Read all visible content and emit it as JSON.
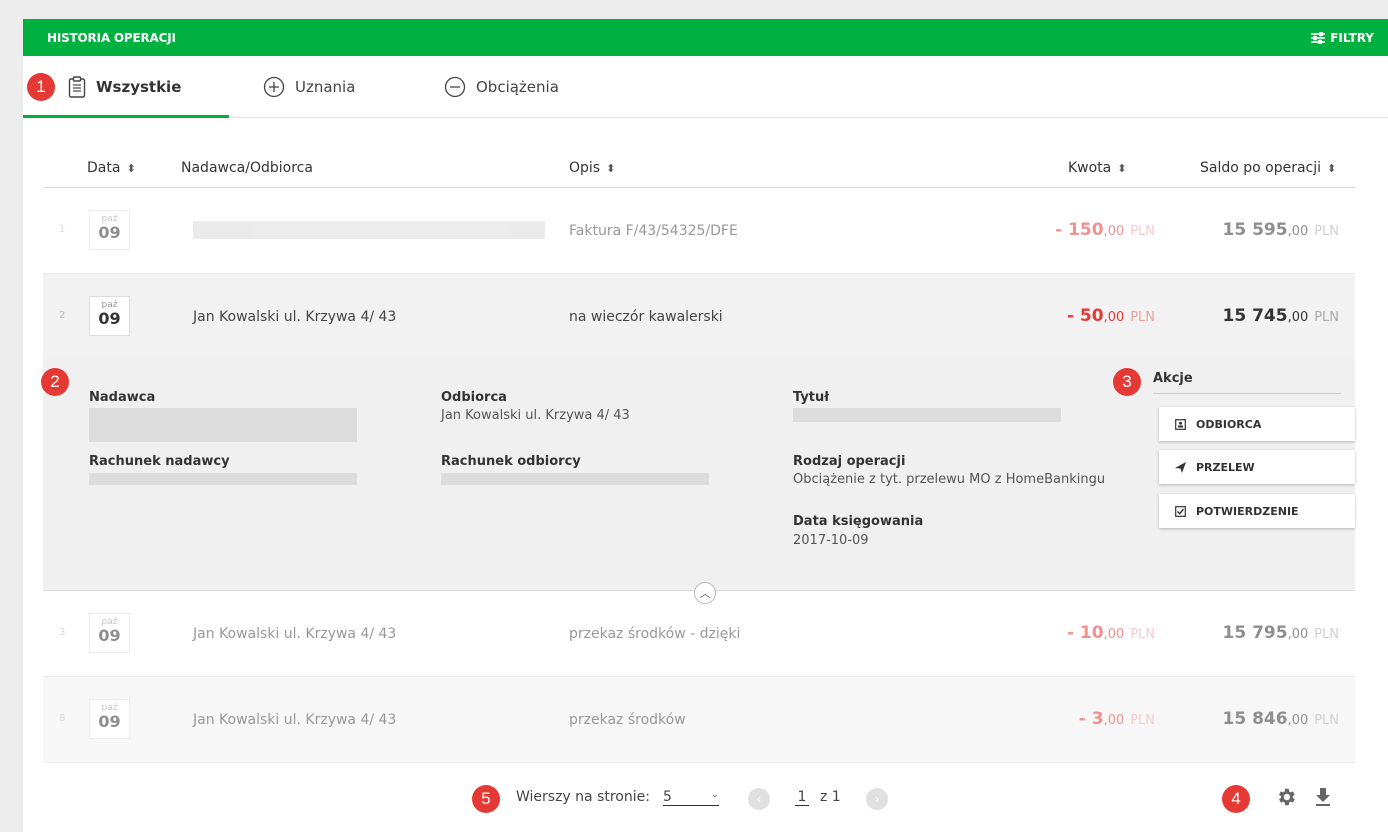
{
  "header": {
    "title": "HISTORIA OPERACJI",
    "filters_label": "FILTRY"
  },
  "tabs": [
    {
      "label": "Wszystkie",
      "icon": "clipboard-icon"
    },
    {
      "label": "Uznania",
      "icon": "plus-circle-icon"
    },
    {
      "label": "Obciążenia",
      "icon": "minus-circle-icon"
    }
  ],
  "badges": [
    "1",
    "2",
    "3",
    "4",
    "5"
  ],
  "columns": {
    "date": "Data",
    "party": "Nadawca/Odbiorca",
    "desc": "Opis",
    "amount": "Kwota",
    "balance": "Saldo po operacji"
  },
  "rows": [
    {
      "num": "1",
      "month": "paź",
      "day": "09",
      "party": "",
      "desc": "Faktura F/43/54325/DFE",
      "amount_int": "- 150",
      "amount_dec": ",00",
      "currency": "PLN",
      "balance_int": "15 595",
      "balance_dec": ",00"
    },
    {
      "num": "2",
      "month": "paź",
      "day": "09",
      "party": "Jan Kowalski ul. Krzywa 4/ 43",
      "desc": "na wieczór kawalerski",
      "amount_int": "- 50",
      "amount_dec": ",00",
      "currency": "PLN",
      "balance_int": "15 745",
      "balance_dec": ",00"
    },
    {
      "num": "3",
      "month": "paź",
      "day": "09",
      "party": "Jan Kowalski ul. Krzywa 4/ 43",
      "desc": "przekaz środków - dzięki",
      "amount_int": "- 10",
      "amount_dec": ",00",
      "currency": "PLN",
      "balance_int": "15 795",
      "balance_dec": ",00"
    },
    {
      "num": "8",
      "month": "paź",
      "day": "09",
      "party": "Jan Kowalski ul. Krzywa 4/ 43",
      "desc": "przekaz środków",
      "amount_int": "- 3",
      "amount_dec": ",00",
      "currency": "PLN",
      "balance_int": "15 846",
      "balance_dec": ",00"
    }
  ],
  "details": {
    "sender_label": "Nadawca",
    "sender_account_label": "Rachunek nadawcy",
    "recipient_label": "Odbiorca",
    "recipient_value": "Jan Kowalski ul. Krzywa 4/ 43",
    "recipient_account_label": "Rachunek odbiorcy",
    "title_label": "Tytuł",
    "op_type_label": "Rodzaj operacji",
    "op_type_value": "Obciążenie z tyt. przelewu MO z HomeBankingu",
    "booking_date_label": "Data księgowania",
    "booking_date_value": "2017-10-09"
  },
  "actions": {
    "title": "Akcje",
    "buttons": [
      {
        "label": "ODBIORCA",
        "icon": "contact-card-icon"
      },
      {
        "label": "PRZELEW",
        "icon": "send-icon"
      },
      {
        "label": "POTWIERDZENIE",
        "icon": "checkbox-icon"
      }
    ]
  },
  "pagination": {
    "rows_label": "Wierszy na stronie:",
    "rows_value": "5",
    "page": "1",
    "of_label": "z 1"
  },
  "footer_icons": [
    "settings-icon",
    "download-icon"
  ],
  "colors": {
    "brand": "#00b140",
    "negative": "#e53935",
    "badge": "#e53935"
  }
}
